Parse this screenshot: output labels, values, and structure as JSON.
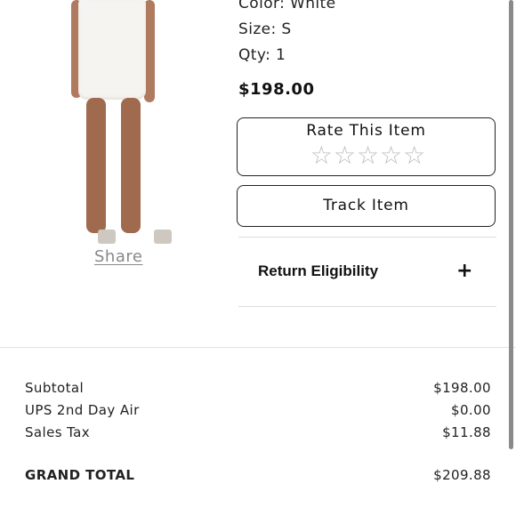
{
  "product": {
    "color": "Color: White",
    "size": "Size: S",
    "qty": "Qty: 1",
    "price": "$198.00",
    "image_icon": "product-photo"
  },
  "share_label": "Share",
  "rate": {
    "title": "Rate This Item",
    "stars": 5,
    "star_icon": "star-outline-icon"
  },
  "track_label": "Track Item",
  "return": {
    "label": "Return Eligibility",
    "expand_icon": "+"
  },
  "summary": {
    "rows": [
      {
        "label": "Subtotal",
        "value": "$198.00"
      },
      {
        "label": "UPS 2nd Day Air",
        "value": "$0.00"
      },
      {
        "label": "Sales Tax",
        "value": "$11.88"
      }
    ],
    "grand_label": "GRAND TOTAL",
    "grand_value": "$209.88"
  }
}
